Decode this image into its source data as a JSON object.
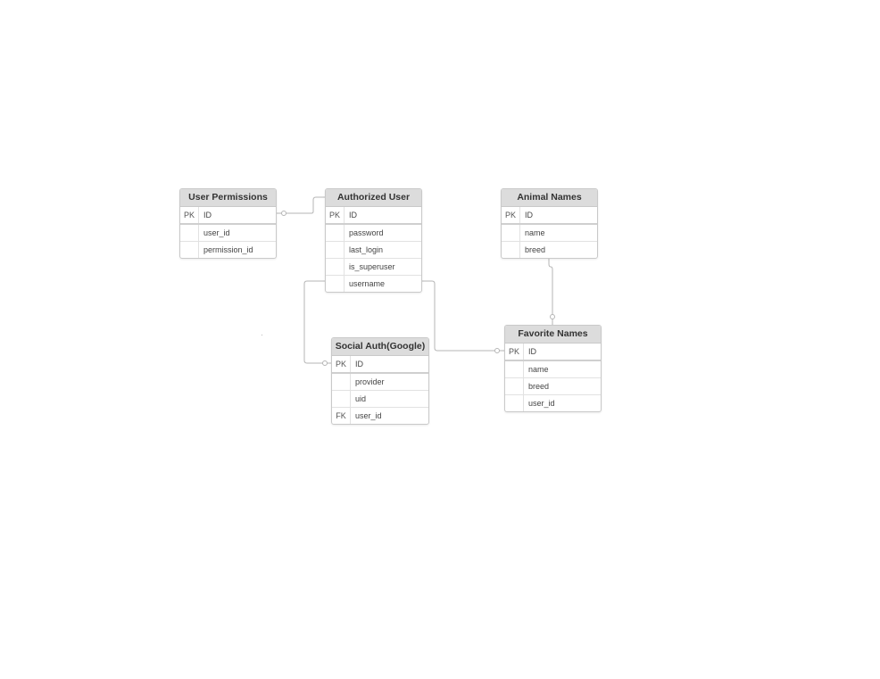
{
  "diagram": {
    "line_color": "#b5b5b5",
    "header_color": "#dcdcdc",
    "entities": {
      "user_permissions": {
        "title": "User Permissions",
        "rows": [
          {
            "key": "PK",
            "field": "ID"
          },
          {
            "key": "",
            "field": "user_id"
          },
          {
            "key": "",
            "field": "permission_id"
          }
        ]
      },
      "authorized_user": {
        "title": "Authorized User",
        "rows": [
          {
            "key": "PK",
            "field": "ID"
          },
          {
            "key": "",
            "field": "password"
          },
          {
            "key": "",
            "field": "last_login"
          },
          {
            "key": "",
            "field": "is_superuser"
          },
          {
            "key": "",
            "field": "username"
          }
        ]
      },
      "animal_names": {
        "title": "Animal Names",
        "rows": [
          {
            "key": "PK",
            "field": "ID"
          },
          {
            "key": "",
            "field": "name"
          },
          {
            "key": "",
            "field": "breed"
          }
        ]
      },
      "social_auth": {
        "title": "Social Auth(Google)",
        "rows": [
          {
            "key": "PK",
            "field": "ID"
          },
          {
            "key": "",
            "field": "provider"
          },
          {
            "key": "",
            "field": "uid"
          },
          {
            "key": "FK",
            "field": "user_id"
          }
        ]
      },
      "favorite_names": {
        "title": "Favorite Names",
        "rows": [
          {
            "key": "PK",
            "field": "ID"
          },
          {
            "key": "",
            "field": "name"
          },
          {
            "key": "",
            "field": "breed"
          },
          {
            "key": "",
            "field": "user_id"
          }
        ]
      }
    }
  }
}
